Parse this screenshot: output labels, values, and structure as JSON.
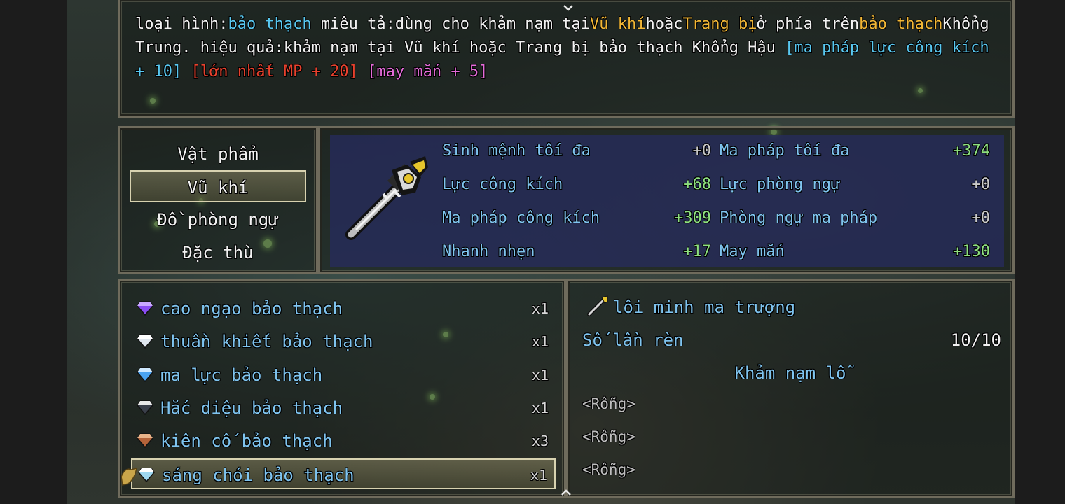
{
  "help": {
    "segments": [
      {
        "text": "loại hình:",
        "color": "white"
      },
      {
        "text": "bảo thạch",
        "color": "blue"
      },
      {
        "text": " miêu tả:dùng cho khảm nạm tại",
        "color": "white"
      },
      {
        "text": "Vũ khí",
        "color": "yellow"
      },
      {
        "text": "hoặc",
        "color": "white"
      },
      {
        "text": "Trang bị",
        "color": "yellow"
      },
      {
        "text": "ở phía trên",
        "color": "white"
      },
      {
        "text": "bảo thạch",
        "color": "yellow"
      },
      {
        "text": "Khổng Trung. hiệu quả:khảm nạm tại Vũ khí hoặc Trang bị bảo thạch Khổng Hậu ",
        "color": "white"
      },
      {
        "text": "[ma pháp lực công kích + 10]",
        "color": "blue"
      },
      {
        "text": " ",
        "color": "white"
      },
      {
        "text": "[lớn nhất MP + 20]",
        "color": "red"
      },
      {
        "text": " ",
        "color": "white"
      },
      {
        "text": "[may mắn + 5]",
        "color": "pink"
      }
    ]
  },
  "categories": {
    "items": [
      "Vật phẩm",
      "Vũ khí",
      "Đồ phòng ngự",
      "Đặc thù"
    ],
    "selected_index": 1
  },
  "equipment_icon": "staff-icon",
  "stats": [
    {
      "label": "Sinh mệnh tối đa",
      "value": "+0",
      "highlight": false
    },
    {
      "label": "Ma pháp tối đa",
      "value": "+374",
      "highlight": true
    },
    {
      "label": "Lực công kích",
      "value": "+68",
      "highlight": true
    },
    {
      "label": "Lực phòng ngự",
      "value": "+0",
      "highlight": false
    },
    {
      "label": "Ma pháp công kích",
      "value": "+309",
      "highlight": true
    },
    {
      "label": "Phòng ngự ma pháp",
      "value": "+0",
      "highlight": false
    },
    {
      "label": "Nhanh nhẹn",
      "value": "+17",
      "highlight": true
    },
    {
      "label": "May mắn",
      "value": "+130",
      "highlight": true
    }
  ],
  "gems": [
    {
      "name": "cao ngạo bảo thạch",
      "qty": "x1",
      "gem_color": "#8a4df2"
    },
    {
      "name": "thuần khiết bảo thạch",
      "qty": "x1",
      "gem_color": "#e8eef5"
    },
    {
      "name": "ma lực bảo thạch",
      "qty": "x1",
      "gem_color": "#4aa3f0"
    },
    {
      "name": "Hắc diệu bảo thạch",
      "qty": "x1",
      "gem_color": "#3a3f4a"
    },
    {
      "name": "kiên cố bảo thạch",
      "qty": "x3",
      "gem_color": "#b5643a"
    },
    {
      "name": "sáng chói bảo thạch",
      "qty": "x1",
      "gem_color": "#9fd8f0"
    }
  ],
  "gems_selected_index": 5,
  "socket": {
    "item_icon": "wand-icon",
    "item_name": "lôi minh ma trượng",
    "forge_label": "Số lần rèn",
    "forge_value": "10/10",
    "sockets_title": "Khảm nạm lỗ",
    "slots": [
      "<Rỗng>",
      "<Rỗng>",
      "<Rỗng>"
    ]
  },
  "colors": {
    "white": "#f2f2f2",
    "blue": "#59c8f0",
    "yellow": "#f2b736",
    "red": "#e8412d",
    "pink": "#e46bd9",
    "stat_label": "#7fc4ef",
    "stat_positive": "#8ee07f",
    "stat_zero": "#c9c9c9"
  }
}
